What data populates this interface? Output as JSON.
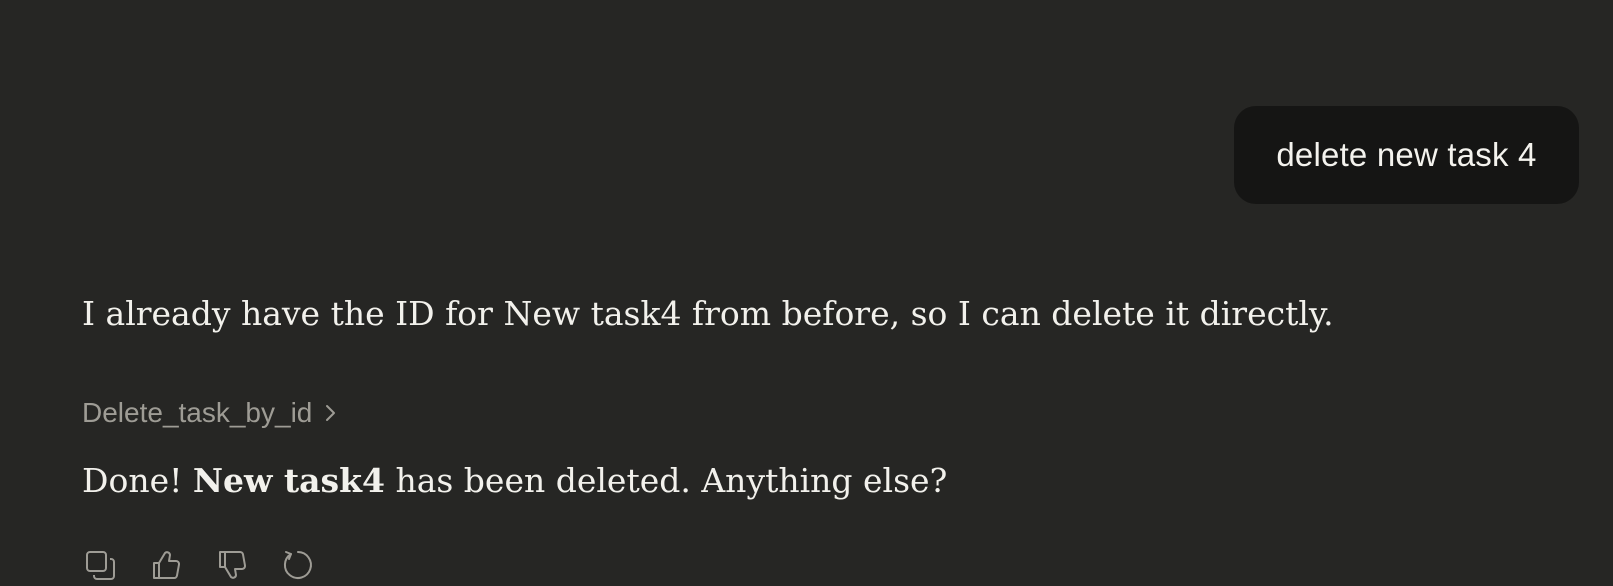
{
  "user_message": {
    "text": "delete new task 4"
  },
  "assistant_message": {
    "intro": "I already have the ID for New task4 from before, so I can delete it directly.",
    "tool_call": {
      "label": "Delete_task_by_id",
      "icon": "chevron-right-icon"
    },
    "response": {
      "prefix": "Done! ",
      "bold": "New task4",
      "suffix": " has been deleted. Anything else?"
    }
  },
  "actions": [
    {
      "name": "copy",
      "icon": "copy-icon"
    },
    {
      "name": "thumbs-up",
      "icon": "thumbs-up-icon"
    },
    {
      "name": "thumbs-down",
      "icon": "thumbs-down-icon"
    },
    {
      "name": "retry",
      "icon": "retry-icon"
    }
  ],
  "colors": {
    "background": "#262624",
    "user_bubble": "#151514",
    "text": "#f2f1ec",
    "muted": "#9e9c95"
  }
}
